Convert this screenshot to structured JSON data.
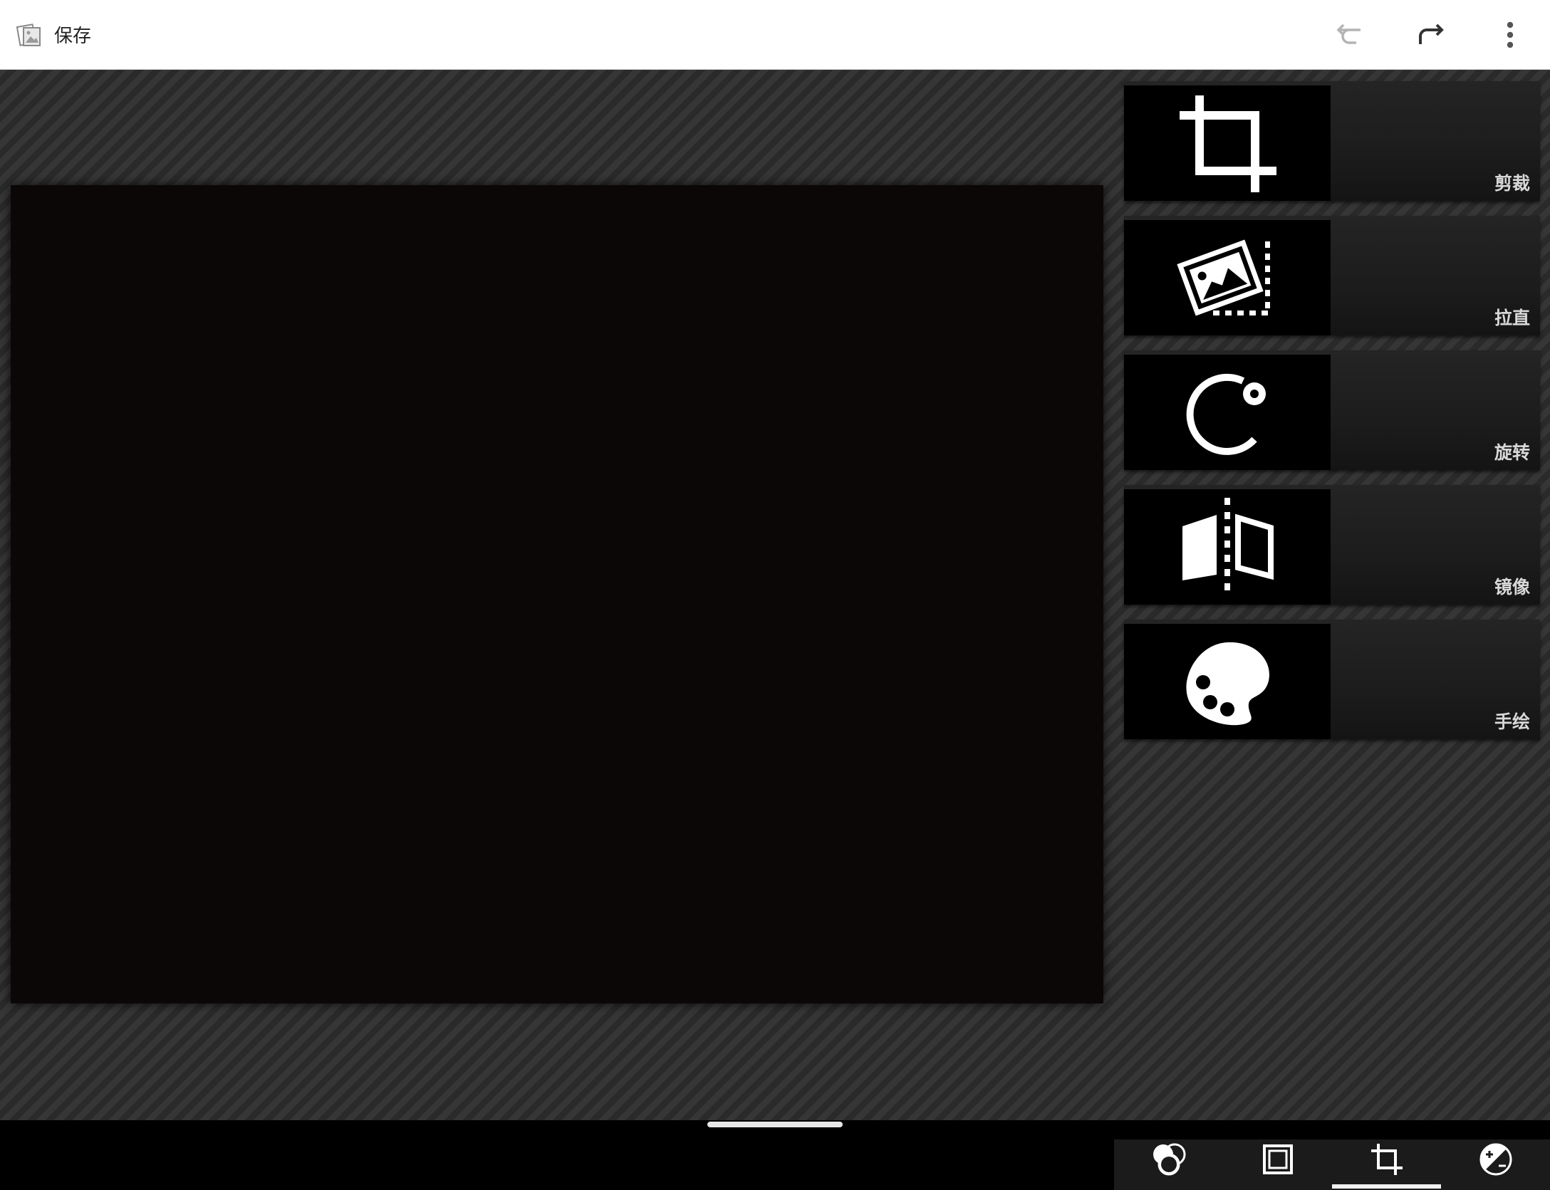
{
  "toolbar": {
    "save_label": "保存",
    "save_icon": "photo-save-icon",
    "undo_icon": "undo-icon",
    "redo_icon": "redo-icon",
    "more_icon": "more-vert-icon",
    "undo_enabled": false,
    "redo_enabled": true
  },
  "tools": [
    {
      "label": "剪裁",
      "icon": "crop-icon"
    },
    {
      "label": "拉直",
      "icon": "straighten-icon"
    },
    {
      "label": "旋转",
      "icon": "rotate-icon"
    },
    {
      "label": "镜像",
      "icon": "mirror-icon"
    },
    {
      "label": "手绘",
      "icon": "palette-icon"
    }
  ],
  "categories": [
    {
      "icon": "filters-icon",
      "active": false
    },
    {
      "icon": "borders-icon",
      "active": false
    },
    {
      "icon": "geometry-icon",
      "active": true
    },
    {
      "icon": "exposure-icon",
      "active": false
    }
  ],
  "colors": {
    "topbar": "#ffffff",
    "canvas": "#0b0707",
    "tool_label": "#d8d8d8",
    "active_indicator": "#f0f0f0"
  }
}
